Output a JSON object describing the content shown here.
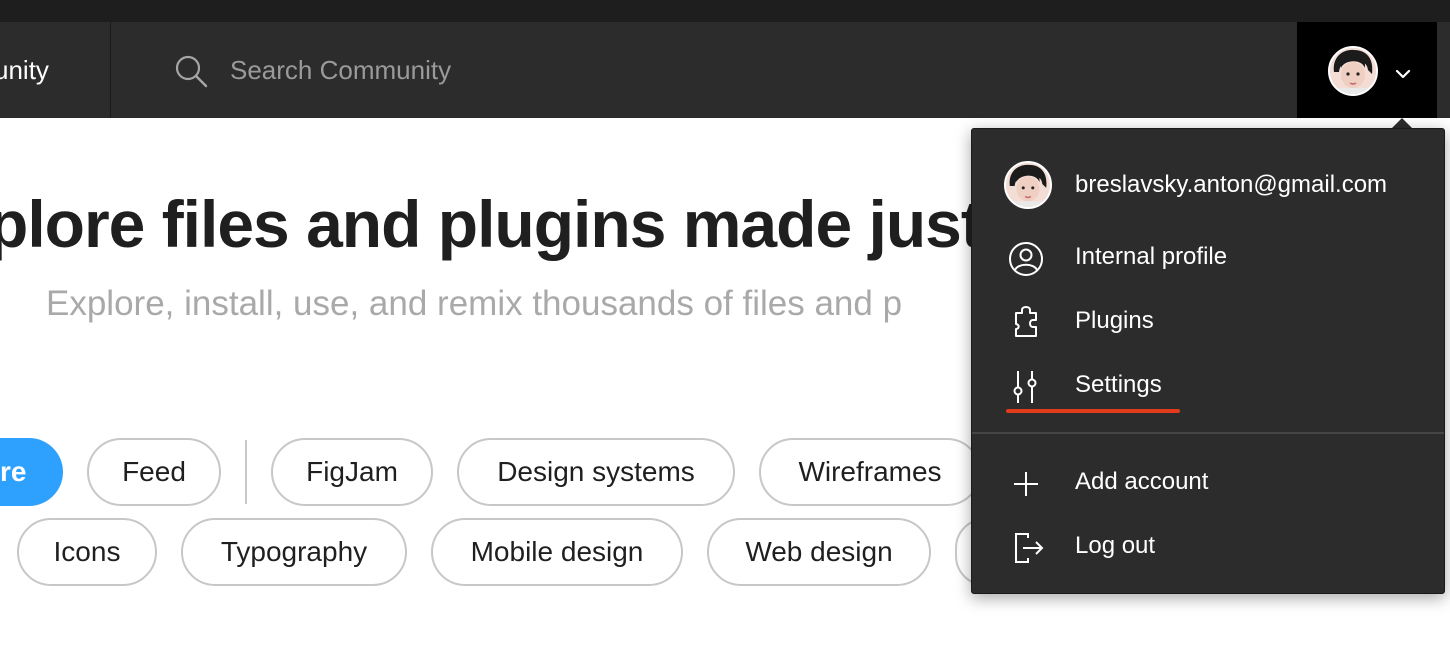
{
  "header": {
    "title": "unity",
    "search": {
      "placeholder": "Search Community",
      "icon": "search-icon"
    },
    "account": {
      "avatar": "avatar",
      "chevron_icon": "chevron-down-icon"
    }
  },
  "hero": {
    "title": "plore files and plugins made just fo",
    "subtitle": "Explore, install, use, and remix thousands of files and p"
  },
  "filters": {
    "active": {
      "label": "re"
    },
    "row1": [
      "Feed",
      "FigJam",
      "Design systems",
      "Wireframes"
    ],
    "row2": [
      "Icons",
      "Typography",
      "Mobile design",
      "Web design"
    ]
  },
  "account_menu": {
    "email": "breslavsky.anton@gmail.com",
    "items": [
      {
        "label": "Internal profile",
        "icon": "user-circle-icon"
      },
      {
        "label": "Plugins",
        "icon": "plugin-icon"
      },
      {
        "label": "Settings",
        "icon": "sliders-icon"
      }
    ],
    "secondary_items": [
      {
        "label": "Add account",
        "icon": "plus-icon"
      },
      {
        "label": "Log out",
        "icon": "logout-icon"
      }
    ],
    "highlight_color": "#e23b1b"
  },
  "colors": {
    "navbar": "#2c2c2c",
    "accent": "#2ea1ff",
    "menu_background": "#2c2c2c"
  }
}
